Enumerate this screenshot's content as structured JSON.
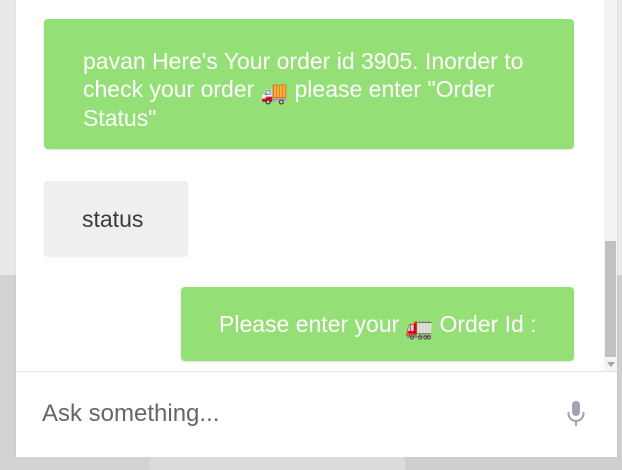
{
  "chat": {
    "messages": [
      {
        "sender": "bot",
        "text_before": "pavan Here's Your order id 3905. Inorder to check your order",
        "emoji": "🚚",
        "emoji_name": "delivery-truck-icon",
        "text_after": "please enter \"Order Status\""
      },
      {
        "sender": "user",
        "text": "status"
      },
      {
        "sender": "bot",
        "text_before": "Please enter your",
        "emoji": "🚛",
        "emoji_name": "truck-icon",
        "text_after": "Order Id :"
      }
    ]
  },
  "input": {
    "placeholder": "Ask something...",
    "value": "",
    "mic_icon": "microphone-icon"
  },
  "colors": {
    "bot_bubble": "#94df76",
    "user_bubble": "#efefef",
    "bot_text": "#ffffff",
    "user_text": "#3a3a3a"
  }
}
